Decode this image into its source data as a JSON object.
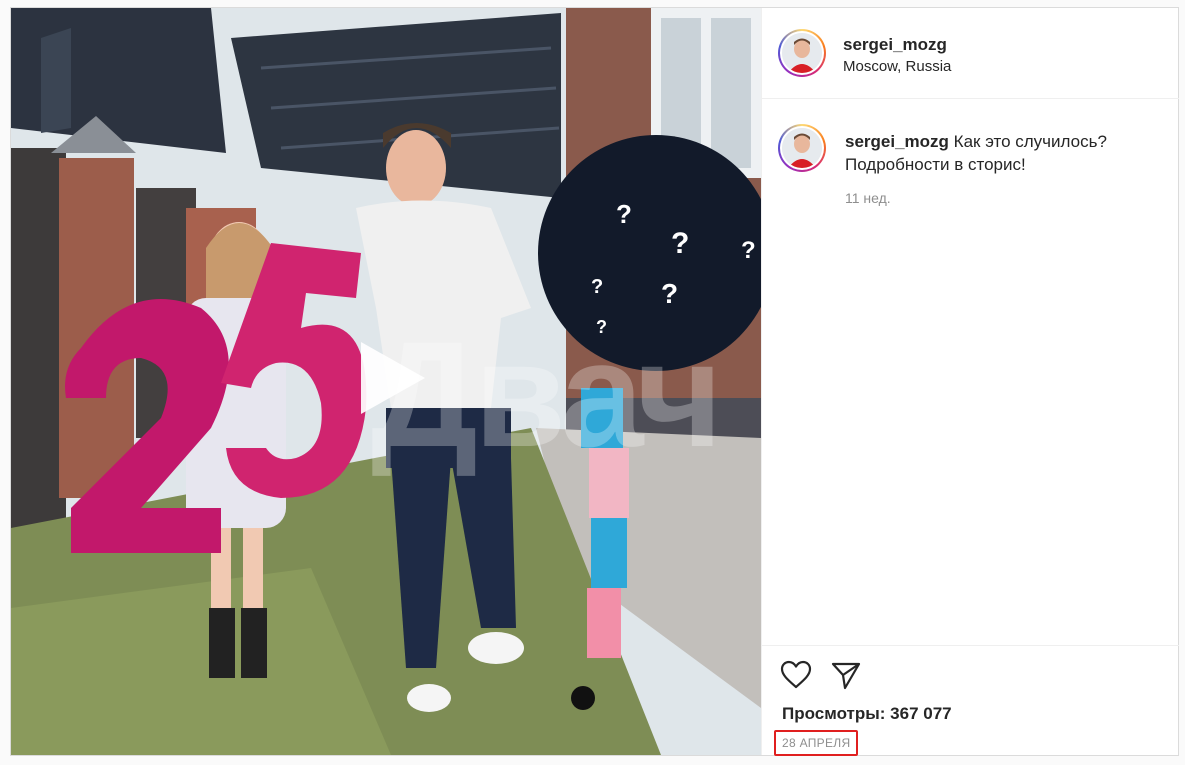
{
  "post": {
    "username": "sergei_mozg",
    "location": "Moscow, Russia",
    "caption": "Как это случилось? Подробности в сторис!",
    "age": "11 нед.",
    "views_label": "Просмотры:",
    "views_count": "367 077",
    "date": "28 АПРЕЛЯ"
  },
  "media": {
    "balloon_number": "25",
    "watermark": "Двач"
  },
  "icons": {
    "like": "heart-icon",
    "share": "share-icon",
    "play": "play-icon"
  },
  "colors": {
    "date_highlight": "#e01f1f",
    "muted_text": "#8e8e8e",
    "border": "#dbdbdb"
  }
}
